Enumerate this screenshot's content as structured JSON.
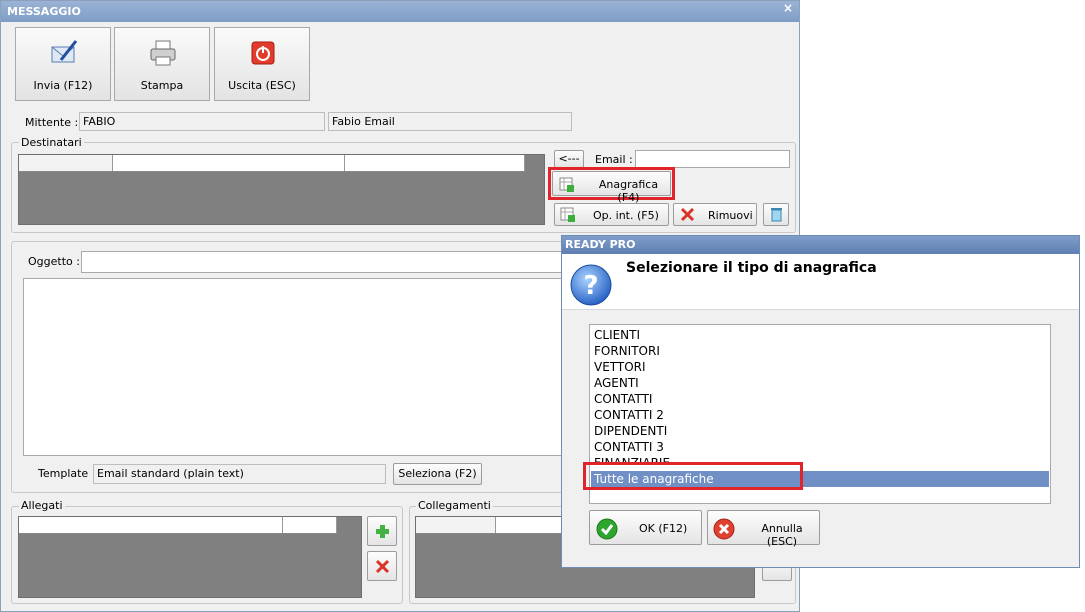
{
  "window": {
    "title": "MESSAGGIO",
    "close": "×"
  },
  "toolbar": {
    "send": "Invia (F12)",
    "print": "Stampa",
    "exit": "Uscita (ESC)"
  },
  "sender": {
    "label": "Mittente :",
    "name": "FABIO",
    "email": "Fabio Email"
  },
  "recipients": {
    "legend": "Destinatari",
    "arrow": "<---",
    "email_label": "Email :",
    "email_value": "",
    "anagrafica": "Anagrafica (F4)",
    "opint": "Op. int. (F5)",
    "remove": "Rimuovi"
  },
  "message": {
    "subject_label": "Oggetto :",
    "subject_value": "",
    "template_label": "Template :",
    "template_value": "Email standard (plain text)",
    "select": "Seleziona (F2)"
  },
  "attachments": {
    "legend": "Allegati"
  },
  "links": {
    "legend": "Collegamenti"
  },
  "dialog": {
    "title": "READY PRO",
    "question": "Selezionare il tipo di anagrafica",
    "items": [
      "CLIENTI",
      "FORNITORI",
      "VETTORI",
      "AGENTI",
      "CONTATTI",
      "CONTATTI 2",
      "DIPENDENTI",
      "CONTATTI 3",
      "FINANZIARIE",
      "Tutte le anagrafiche"
    ],
    "selected": "Tutte le anagrafiche",
    "ok": "OK (F12)",
    "cancel": "Annulla (ESC)"
  },
  "colors": {
    "highlight": "#e0242b",
    "selection": "#6f8fc5"
  }
}
